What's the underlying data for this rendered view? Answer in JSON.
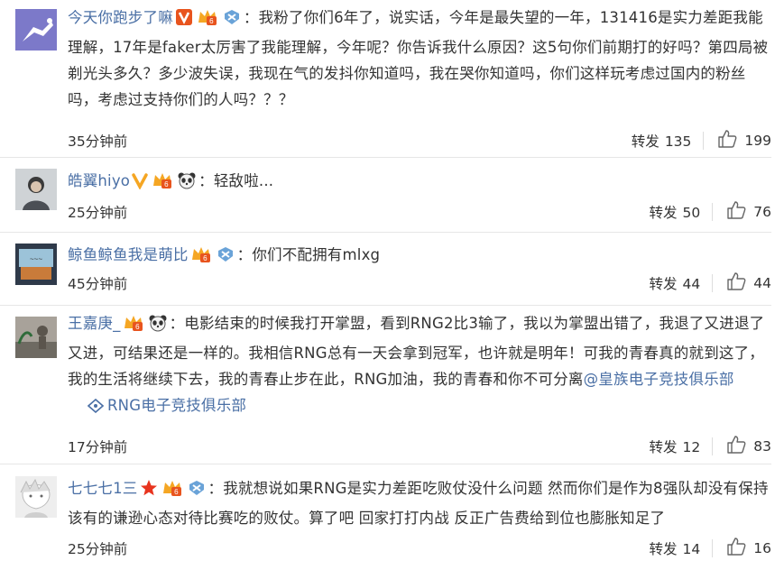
{
  "comments": [
    {
      "username": "今天你跑步了嘛",
      "separator": "：",
      "text": "我粉了你们6年了，说实话，今年是最失望的一年，131416是实力差距我能理解，17年是faker太厉害了我能理解，今年呢？你告诉我什么原因？这5句你们前期打的好吗？第四局被剃光头多久？多少波失误，我现在气的发抖你知道吗，我在哭你知道吗，你们这样玩考虑过国内的粉丝吗，考虑过支持你们的人吗？？？",
      "time": "35分钟前",
      "repost_label": "转发",
      "repost_count": "135",
      "like_count": "199"
    },
    {
      "username": "皓翼hiyo",
      "separator": "：",
      "text": "轻敌啦...",
      "time": "25分钟前",
      "repost_label": "转发",
      "repost_count": "50",
      "like_count": "76"
    },
    {
      "username": "鲸鱼鲸鱼我是萌比",
      "separator": "：",
      "text": "你们不配拥有mlxg",
      "time": "45分钟前",
      "repost_label": "转发",
      "repost_count": "44",
      "like_count": "44"
    },
    {
      "username": "王嘉庚_",
      "separator": "：",
      "text": "电影结束的时候我打开掌盟，看到RNG2比3输了，我以为掌盟出错了，我退了又进退了又进，可结果还是一样的。我相信RNG总有一天会拿到冠军，也许就是明年！可我的青春真的就到这了，我的生活将继续下去，我的青春止步在此，RNG加油，我的青春和你不可分离",
      "mention": "@皇族电子竞技俱乐部",
      "topic": "RNG电子竞技俱乐部",
      "time": "17分钟前",
      "repost_label": "转发",
      "repost_count": "12",
      "like_count": "83"
    },
    {
      "username": "七七七1三",
      "separator": "：",
      "text": "我就想说如果RNG是实力差距吃败仗没什么问题 然而你们是作为8强队却没有保持该有的谦逊心态对待比赛吃的败仗。算了吧 回家打打内战 反正广告费给到位也膨胀知足了",
      "time": "25分钟前",
      "repost_label": "转发",
      "repost_count": "14",
      "like_count": "16"
    }
  ],
  "colors": {
    "link": "#4a6fa5",
    "text": "#333333",
    "divider": "#e6e6e6",
    "verified_orange": "#e8541e",
    "vip_gold": "#f5a623"
  }
}
